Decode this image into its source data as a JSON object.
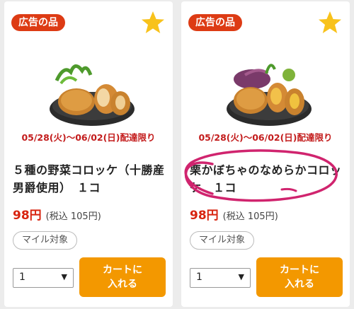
{
  "colors": {
    "badge": "#dd3b14",
    "star": "#f8c21b",
    "period": "#c31c1c",
    "price": "#d8240f",
    "cart_button": "#f39800",
    "annotation": "#d0246e"
  },
  "products": [
    {
      "badge": "広告の品",
      "favorite_icon": "star-icon",
      "period": "05/28(火)～06/02(日)配達限り",
      "name": "５種の野菜コロッケ（十勝産男爵使用）　１コ",
      "price": "98円",
      "price_tax": "(税込 105円)",
      "tag": "マイル対象",
      "quantity": "1",
      "cart_line1": "カートに",
      "cart_line2": "入れる"
    },
    {
      "badge": "広告の品",
      "favorite_icon": "star-icon",
      "period": "05/28(火)～06/02(日)配達限り",
      "name": "栗かぼちゃのなめらかコロッケ　１コ",
      "price": "98円",
      "price_tax": "(税込 105円)",
      "tag": "マイル対象",
      "quantity": "1",
      "cart_line1": "カートに",
      "cart_line2": "入れる"
    }
  ]
}
